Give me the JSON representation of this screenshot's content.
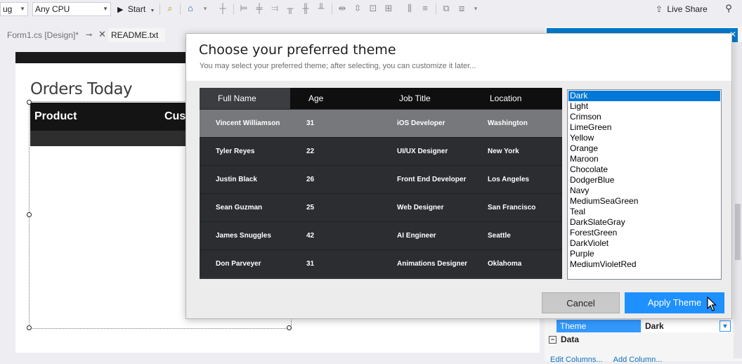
{
  "toolbar": {
    "config_value": "ug",
    "platform_value": "Any CPU",
    "start_label": "Start",
    "live_share_label": "Live Share"
  },
  "tabs": [
    {
      "label": "Form1.cs [Design]*"
    },
    {
      "label": "README.txt"
    }
  ],
  "designer": {
    "form_title": "Orders Today",
    "grid_headers": [
      "Product",
      "Cust"
    ]
  },
  "dialog": {
    "title": "Choose your preferred theme",
    "subtitle": "You may select your preferred theme; after selecting, you can customize it later...",
    "columns": [
      "Full Name",
      "Age",
      "Job Title",
      "Location"
    ],
    "rows": [
      {
        "name": "Vincent Williamson",
        "age": "31",
        "job": "iOS Developer",
        "location": "Washington"
      },
      {
        "name": "Tyler Reyes",
        "age": "22",
        "job": "UI/UX Designer",
        "location": "New York"
      },
      {
        "name": "Justin Black",
        "age": "26",
        "job": "Front End Developer",
        "location": "Los Angeles"
      },
      {
        "name": "Sean Guzman",
        "age": "25",
        "job": "Web Designer",
        "location": "San Francisco"
      },
      {
        "name": "James Snuggles",
        "age": "42",
        "job": "AI Engineer",
        "location": "Seattle"
      },
      {
        "name": "Don Parveyer",
        "age": "31",
        "job": "Animations Designer",
        "location": "Oklahoma"
      }
    ],
    "themes": [
      "Dark",
      "Light",
      "Crimson",
      "LimeGreen",
      "Yellow",
      "Orange",
      "Maroon",
      "Chocolate",
      "DodgerBlue",
      "Navy",
      "MediumSeaGreen",
      "Teal",
      "DarkSlateGray",
      "ForestGreen",
      "DarkViolet",
      "Purple",
      "MediumVioletRed"
    ],
    "selected_theme": "Dark",
    "cancel_label": "Cancel",
    "apply_label": "Apply Theme"
  },
  "properties": {
    "theme_label": "Theme",
    "theme_value": "Dark",
    "data_category": "Data",
    "links": [
      "Edit Columns...",
      "Add Column..."
    ]
  },
  "colors": {
    "accent": "#007acc",
    "apply_button": "#1e90ff",
    "selected_item": "#0078d7",
    "grid_dark": "#2b2d31"
  },
  "icons": [
    "play-icon",
    "live-share-icon",
    "person-icon",
    "close-icon",
    "pin-icon",
    "cursor-icon"
  ]
}
